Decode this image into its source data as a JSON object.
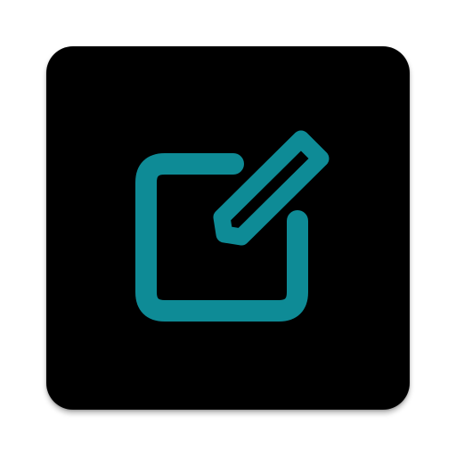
{
  "app_icon": {
    "icon": "edit-note-icon",
    "background_color": "#000000",
    "accent_color": "#0e8b96"
  }
}
